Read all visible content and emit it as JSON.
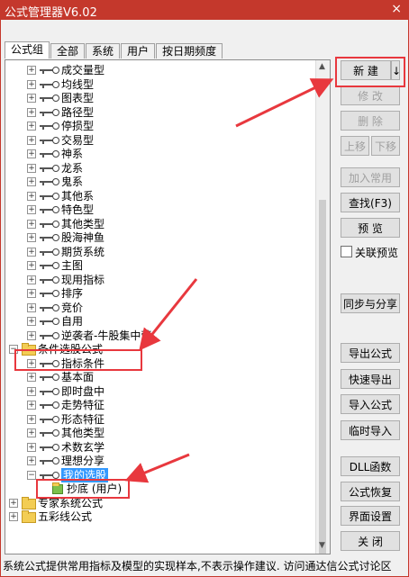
{
  "window": {
    "title": "公式管理器V6.02",
    "close": "×"
  },
  "tabs": [
    "公式组",
    "全部",
    "系统",
    "用户",
    "按日期频度"
  ],
  "tree": [
    {
      "label": "成交量型",
      "kind": "key"
    },
    {
      "label": "均线型",
      "kind": "key"
    },
    {
      "label": "图表型",
      "kind": "key"
    },
    {
      "label": "路径型",
      "kind": "key"
    },
    {
      "label": "停损型",
      "kind": "key"
    },
    {
      "label": "交易型",
      "kind": "key"
    },
    {
      "label": "神系",
      "kind": "key"
    },
    {
      "label": "龙系",
      "kind": "key"
    },
    {
      "label": "鬼系",
      "kind": "key"
    },
    {
      "label": "其他系",
      "kind": "key"
    },
    {
      "label": "特色型",
      "kind": "key"
    },
    {
      "label": "其他类型",
      "kind": "key"
    },
    {
      "label": "股海神鱼",
      "kind": "key"
    },
    {
      "label": "期货系统",
      "kind": "key"
    },
    {
      "label": "主图",
      "kind": "key"
    },
    {
      "label": "现用指标",
      "kind": "key"
    },
    {
      "label": "排序",
      "kind": "key"
    },
    {
      "label": "竞价",
      "kind": "key"
    },
    {
      "label": "自用",
      "kind": "key"
    },
    {
      "label": "逆袭者-牛股集中营",
      "kind": "key"
    },
    {
      "label": "条件选股公式",
      "kind": "folder"
    },
    {
      "label": "指标条件",
      "kind": "key"
    },
    {
      "label": "基本面",
      "kind": "key"
    },
    {
      "label": "即时盘中",
      "kind": "key"
    },
    {
      "label": "走势特征",
      "kind": "key"
    },
    {
      "label": "形态特征",
      "kind": "key"
    },
    {
      "label": "其他类型",
      "kind": "key"
    },
    {
      "label": "术数玄学",
      "kind": "key"
    },
    {
      "label": "理想分享",
      "kind": "key"
    },
    {
      "label": "我的选股",
      "kind": "key",
      "selected": true
    },
    {
      "label": "抄底  (用户)",
      "kind": "leaf"
    },
    {
      "label": "专家系统公式",
      "kind": "folder"
    },
    {
      "label": "五彩线公式",
      "kind": "folder"
    }
  ],
  "buttons": {
    "new": "新  建",
    "new_arrow": "↓",
    "modify": "修  改",
    "delete": "删  除",
    "move_up": "上移",
    "move_down": "下移",
    "add_common": "加入常用",
    "find": "查找(F3)",
    "preview": "预  览",
    "linked_preview": "关联预览",
    "sync_share": "同步与分享",
    "export": "导出公式",
    "quick_export": "快速导出",
    "import": "导入公式",
    "temp_import": "临时导入",
    "dll": "DLL函数",
    "restore": "公式恢复",
    "ui_settings": "界面设置",
    "close": "关  闭"
  },
  "status_text": "系统公式提供常用指标及模型的实现样本,不表示操作建议. 访问通达信公式讨论区",
  "colors": {
    "title_bar": "#c4382c",
    "highlight": "#e8383e",
    "selection": "#3399ff"
  }
}
